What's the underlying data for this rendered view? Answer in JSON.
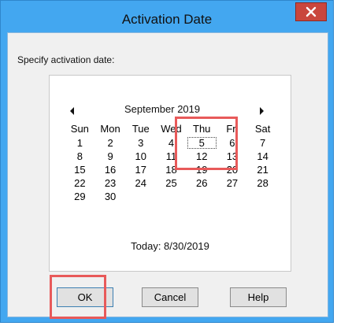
{
  "window": {
    "title": "Activation Date",
    "close_label": "X"
  },
  "prompt": "Specify activation date:",
  "calendar": {
    "month_label": "September 2019",
    "weekdays": [
      "Sun",
      "Mon",
      "Tue",
      "Wed",
      "Thu",
      "Fri",
      "Sat"
    ],
    "weeks": [
      [
        "1",
        "2",
        "3",
        "4",
        "5",
        "6",
        "7"
      ],
      [
        "8",
        "9",
        "10",
        "11",
        "12",
        "13",
        "14"
      ],
      [
        "15",
        "16",
        "17",
        "18",
        "19",
        "20",
        "21"
      ],
      [
        "22",
        "23",
        "24",
        "25",
        "26",
        "27",
        "28"
      ],
      [
        "29",
        "30",
        "",
        "",
        "",
        "",
        ""
      ]
    ],
    "selected_day": "5",
    "today_label": "Today: 8/30/2019"
  },
  "buttons": {
    "ok": "OK",
    "cancel": "Cancel",
    "help": "Help"
  },
  "colors": {
    "titlebar": "#43a7f0",
    "close": "#c9463d",
    "annotation": "#e85a5a"
  }
}
